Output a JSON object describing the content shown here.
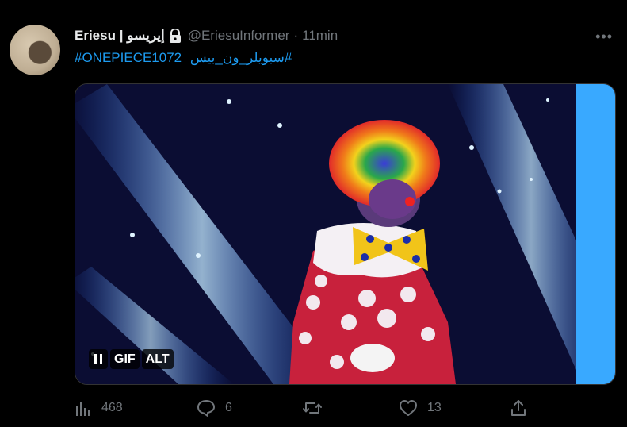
{
  "tweet": {
    "author_name": "Eriesu | إيريسو",
    "handle": "@EriesuInformer",
    "separator": "·",
    "time": "11min",
    "hashtags": [
      "#ONEPIECE1072",
      "#سبويلر_ون_بيس"
    ]
  },
  "media": {
    "controls": {
      "pause_icon": "pause-icon",
      "gif_label": "GIF",
      "alt_label": "ALT"
    }
  },
  "actions": {
    "views": {
      "icon": "bar-chart-icon",
      "count": "468"
    },
    "replies": {
      "icon": "comment-icon",
      "count": "6"
    },
    "retweets": {
      "icon": "retweet-icon",
      "count": ""
    },
    "likes": {
      "icon": "heart-icon",
      "count": "13"
    },
    "share": {
      "icon": "share-icon"
    }
  },
  "colors": {
    "background": "#000000",
    "text": "#e7e9ea",
    "muted": "#71767b",
    "link": "#1d9bf0"
  }
}
